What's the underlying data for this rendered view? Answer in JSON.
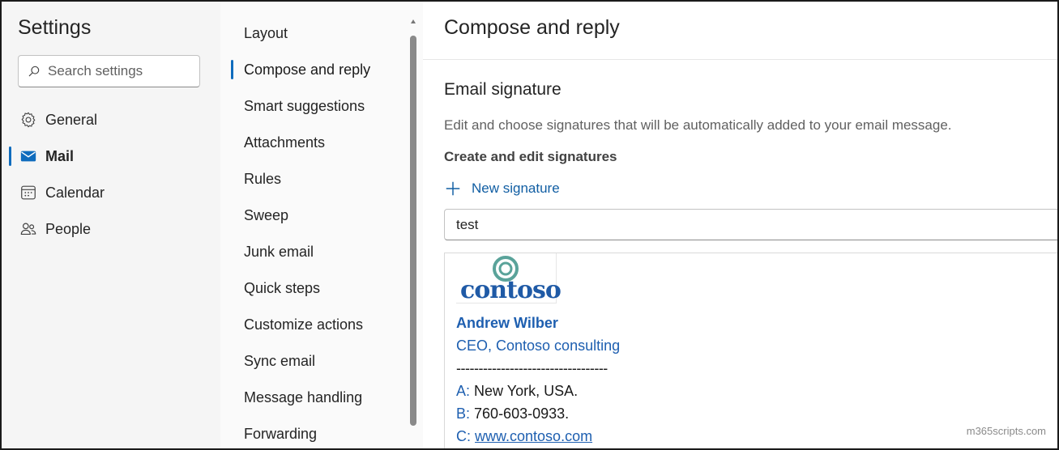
{
  "leftnav": {
    "title": "Settings",
    "search_placeholder": "Search settings",
    "items": [
      {
        "label": "General",
        "icon": "gear-icon"
      },
      {
        "label": "Mail",
        "icon": "mail-icon",
        "active": true
      },
      {
        "label": "Calendar",
        "icon": "calendar-icon"
      },
      {
        "label": "People",
        "icon": "people-icon"
      }
    ]
  },
  "subnav": {
    "items": [
      {
        "label": "Layout"
      },
      {
        "label": "Compose and reply",
        "active": true
      },
      {
        "label": "Smart suggestions"
      },
      {
        "label": "Attachments"
      },
      {
        "label": "Rules"
      },
      {
        "label": "Sweep"
      },
      {
        "label": "Junk email"
      },
      {
        "label": "Quick steps"
      },
      {
        "label": "Customize actions"
      },
      {
        "label": "Sync email"
      },
      {
        "label": "Message handling"
      },
      {
        "label": "Forwarding"
      }
    ]
  },
  "main": {
    "title": "Compose and reply",
    "section_title": "Email signature",
    "section_desc": "Edit and choose signatures that will be automatically added to your email message.",
    "sub_heading": "Create and edit signatures",
    "new_signature_label": "New signature",
    "signature_name_value": "test",
    "signature": {
      "logo_text": "contoso",
      "name": "Andrew Wilber",
      "role": "CEO, Contoso consulting",
      "divider": "----------------------------------",
      "address_key": "A:",
      "address_value": "New York, USA.",
      "phone_key": "B:",
      "phone_value": "760-603-0933.",
      "web_key": "C:",
      "web_value": "www.contoso.com"
    }
  },
  "watermark": "m365scripts.com",
  "colors": {
    "accent": "#0f6cbd",
    "link": "#115ea3",
    "signature_blue": "#1e5fb0",
    "logo_teal": "#5aa39a"
  }
}
